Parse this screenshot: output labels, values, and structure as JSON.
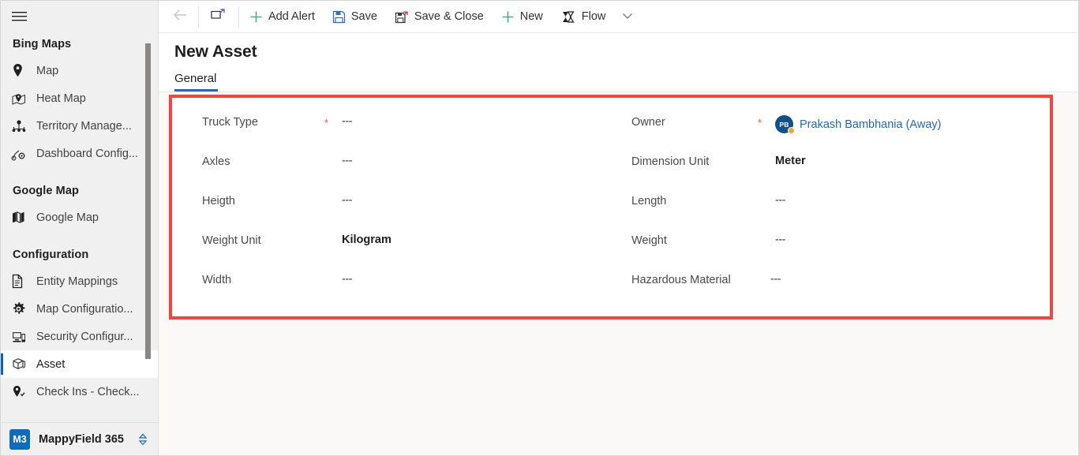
{
  "sidebar": {
    "menu_icon": "hamburger-icon",
    "groups": [
      {
        "title": "Bing Maps",
        "items": [
          {
            "label": "Map",
            "icon": "map-pin-icon",
            "selected": false
          },
          {
            "label": "Heat Map",
            "icon": "heat-map-icon",
            "selected": false
          },
          {
            "label": "Territory Manage...",
            "icon": "territory-management-icon",
            "selected": false
          },
          {
            "label": "Dashboard Config...",
            "icon": "dashboard-config-icon",
            "selected": false
          }
        ]
      },
      {
        "title": "Google Map",
        "items": [
          {
            "label": "Google Map",
            "icon": "folded-map-icon",
            "selected": false
          }
        ]
      },
      {
        "title": "Configuration",
        "items": [
          {
            "label": "Entity Mappings",
            "icon": "document-icon",
            "selected": false
          },
          {
            "label": "Map Configuratio...",
            "icon": "gear-icon",
            "selected": false
          },
          {
            "label": "Security Configur...",
            "icon": "security-icon",
            "selected": false
          },
          {
            "label": "Asset",
            "icon": "asset-box-icon",
            "selected": true
          },
          {
            "label": "Check Ins - Check...",
            "icon": "check-in-pin-icon",
            "selected": false
          }
        ]
      }
    ],
    "footer": {
      "badge": "M3",
      "app_name": "MappyField 365",
      "switcher_icon": "up-down-chevron-icon"
    }
  },
  "command_bar": {
    "back_icon": "back-arrow-icon",
    "popout_icon": "open-in-new-window-icon",
    "buttons": [
      {
        "label": "Add Alert",
        "icon": "plus-icon"
      },
      {
        "label": "Save",
        "icon": "save-floppy-icon"
      },
      {
        "label": "Save & Close",
        "icon": "save-and-close-icon"
      },
      {
        "label": "New",
        "icon": "plus-icon"
      },
      {
        "label": "Flow",
        "icon": "flow-icon"
      }
    ],
    "overflow_icon": "chevron-down-icon"
  },
  "header": {
    "title": "New Asset",
    "tabs": [
      {
        "label": "General",
        "active": true
      }
    ]
  },
  "form": {
    "left_column": [
      {
        "label": "Truck Type",
        "required": true,
        "value": "---",
        "bold": false
      },
      {
        "label": "Axles",
        "required": false,
        "value": "---",
        "bold": false
      },
      {
        "label": "Heigth",
        "required": false,
        "value": "---",
        "bold": false
      },
      {
        "label": "Weight Unit",
        "required": false,
        "value": "Kilogram",
        "bold": true
      },
      {
        "label": "Width",
        "required": false,
        "value": "---",
        "bold": false
      }
    ],
    "right_column": [
      {
        "label": "Owner",
        "required": true,
        "value": "Prakash Bambhania (Away)",
        "type": "lookup",
        "avatar_initials": "PB",
        "presence": "Away"
      },
      {
        "label": "Dimension Unit",
        "required": false,
        "value": "Meter",
        "bold": true
      },
      {
        "label": "Length",
        "required": false,
        "value": "---",
        "bold": false
      },
      {
        "label": "Weight",
        "required": false,
        "value": "---",
        "bold": false
      },
      {
        "label": "Hazardous Material",
        "required": false,
        "value": "---",
        "bold": false
      }
    ],
    "required_marker": "*"
  },
  "annotation": {
    "highlight_color": "#f8423f"
  },
  "colors": {
    "accent_blue": "#0f6cbd",
    "tab_underline": "#2266cc",
    "link_blue": "#1f66c9",
    "required_red": "#e8544a",
    "presence_away": "#f5a623",
    "sidebar_bg": "#f0f0f0",
    "content_bg": "#faf9f8"
  }
}
